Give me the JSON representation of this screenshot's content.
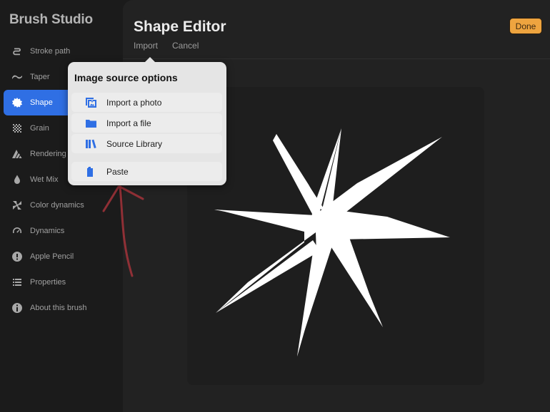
{
  "sidebar": {
    "title": "Brush Studio",
    "items": [
      {
        "label": "Stroke path",
        "icon": "stroke-path-icon",
        "active": false
      },
      {
        "label": "Taper",
        "icon": "taper-icon",
        "active": false
      },
      {
        "label": "Shape",
        "icon": "shape-icon",
        "active": true
      },
      {
        "label": "Grain",
        "icon": "grain-icon",
        "active": false
      },
      {
        "label": "Rendering",
        "icon": "rendering-icon",
        "active": false
      },
      {
        "label": "Wet Mix",
        "icon": "wet-mix-icon",
        "active": false
      },
      {
        "label": "Color dynamics",
        "icon": "color-dynamics-icon",
        "active": false
      },
      {
        "label": "Dynamics",
        "icon": "dynamics-icon",
        "active": false
      },
      {
        "label": "Apple Pencil",
        "icon": "apple-pencil-icon",
        "active": false
      },
      {
        "label": "Properties",
        "icon": "properties-icon",
        "active": false
      },
      {
        "label": "About this brush",
        "icon": "info-icon",
        "active": false
      }
    ]
  },
  "header": {
    "title": "Shape Editor",
    "import_label": "Import",
    "cancel_label": "Cancel",
    "done_label": "Done"
  },
  "popover": {
    "title": "Image source options",
    "options": [
      {
        "label": "Import a photo",
        "icon": "photo-icon"
      },
      {
        "label": "Import a file",
        "icon": "folder-icon"
      },
      {
        "label": "Source Library",
        "icon": "library-icon"
      },
      {
        "label": "Paste",
        "icon": "clipboard-icon"
      }
    ]
  },
  "colors": {
    "accent": "#2f6fe4",
    "done_button": "#eea43f",
    "annotation_arrow": "#a3323a",
    "shape_fill": "#ffffff"
  }
}
